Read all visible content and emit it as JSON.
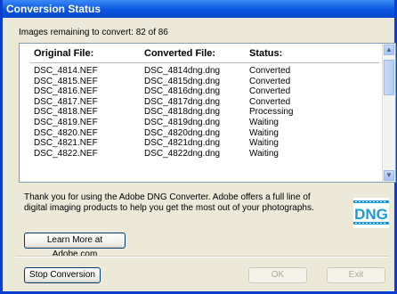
{
  "window": {
    "title": "Conversion Status"
  },
  "status": {
    "remaining_text": "Images remaining to convert: 82 of 86"
  },
  "list": {
    "headers": [
      "Original File:",
      "Converted File:",
      "Status:"
    ],
    "rows": [
      [
        "DSC_4814.NEF",
        "DSC_4814dng.dng",
        "Converted"
      ],
      [
        "DSC_4815.NEF",
        "DSC_4815dng.dng",
        "Converted"
      ],
      [
        "DSC_4816.NEF",
        "DSC_4816dng.dng",
        "Converted"
      ],
      [
        "DSC_4817.NEF",
        "DSC_4817dng.dng",
        "Converted"
      ],
      [
        "DSC_4818.NEF",
        "DSC_4818dng.dng",
        "Processing"
      ],
      [
        "DSC_4819.NEF",
        "DSC_4819dng.dng",
        "Waiting"
      ],
      [
        "DSC_4820.NEF",
        "DSC_4820dng.dng",
        "Waiting"
      ],
      [
        "DSC_4821.NEF",
        "DSC_4821dng.dng",
        "Waiting"
      ],
      [
        "DSC_4822.NEF",
        "DSC_4822dng.dng",
        "Waiting"
      ]
    ]
  },
  "message": {
    "thanks": "Thank you for using the Adobe DNG Converter.  Adobe offers a full line of digital imaging products to help you get the most out of your photographs."
  },
  "logo": {
    "text": "DNG",
    "color": "#1a9bd7"
  },
  "buttons": {
    "learn_more": "Learn More at Adobe.com",
    "stop": "Stop Conversion",
    "ok": "OK",
    "exit": "Exit"
  }
}
